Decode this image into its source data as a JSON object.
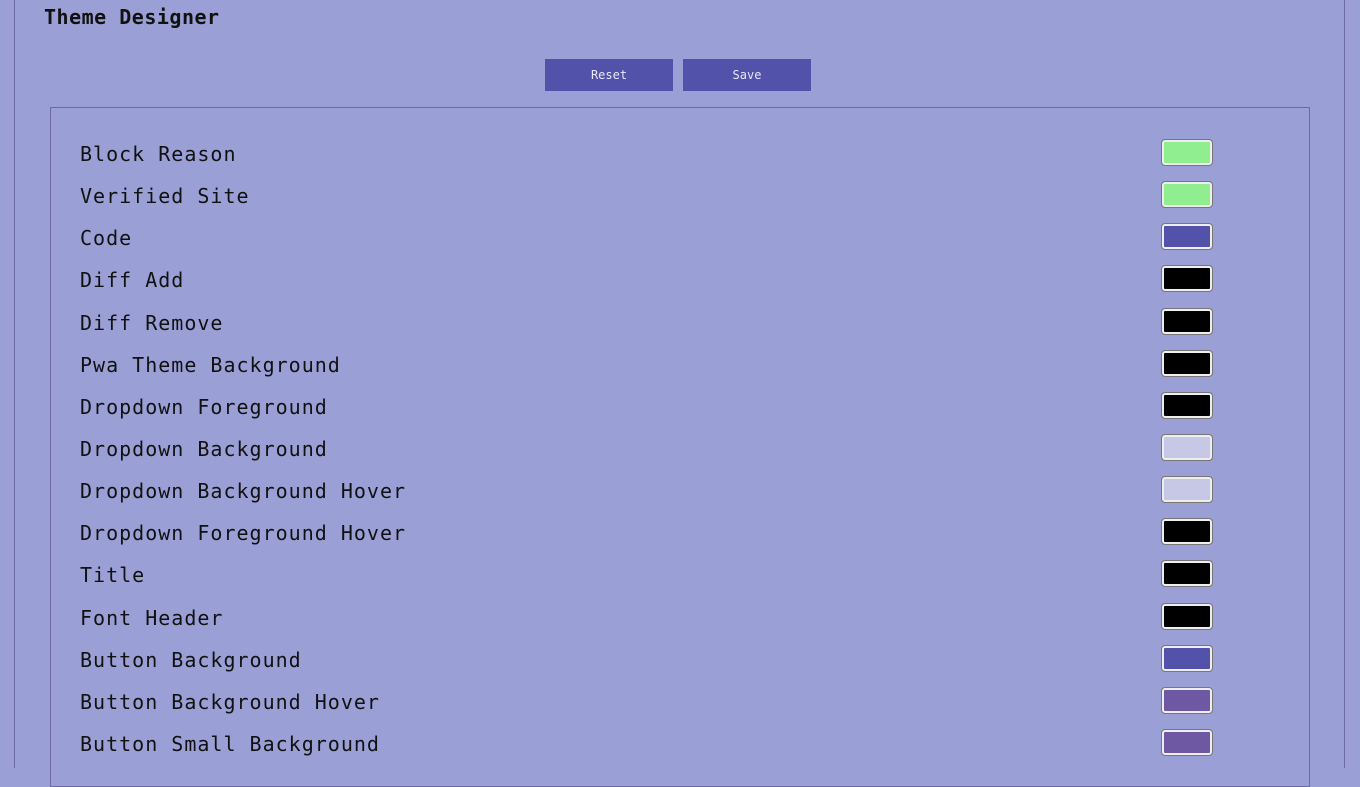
{
  "header": {
    "title": "Theme Designer"
  },
  "toolbar": {
    "reset_label": "Reset",
    "save_label": "Save"
  },
  "colors": [
    {
      "label": "Block Reason",
      "color": "#90ee90"
    },
    {
      "label": "Verified Site",
      "color": "#90ee90"
    },
    {
      "label": "Code",
      "color": "#5252aa"
    },
    {
      "label": "Diff Add",
      "color": "#000000"
    },
    {
      "label": "Diff Remove",
      "color": "#000000"
    },
    {
      "label": "Pwa Theme Background",
      "color": "#000000"
    },
    {
      "label": "Dropdown Foreground",
      "color": "#000000"
    },
    {
      "label": "Dropdown Background",
      "color": "#c6c8e6"
    },
    {
      "label": "Dropdown Background Hover",
      "color": "#c6c8e6"
    },
    {
      "label": "Dropdown Foreground Hover",
      "color": "#000000"
    },
    {
      "label": "Title",
      "color": "#000000"
    },
    {
      "label": "Font Header",
      "color": "#000000"
    },
    {
      "label": "Button Background",
      "color": "#5252aa"
    },
    {
      "label": "Button Background Hover",
      "color": "#6e57a3"
    },
    {
      "label": "Button Small Background",
      "color": "#6e57a3"
    }
  ]
}
